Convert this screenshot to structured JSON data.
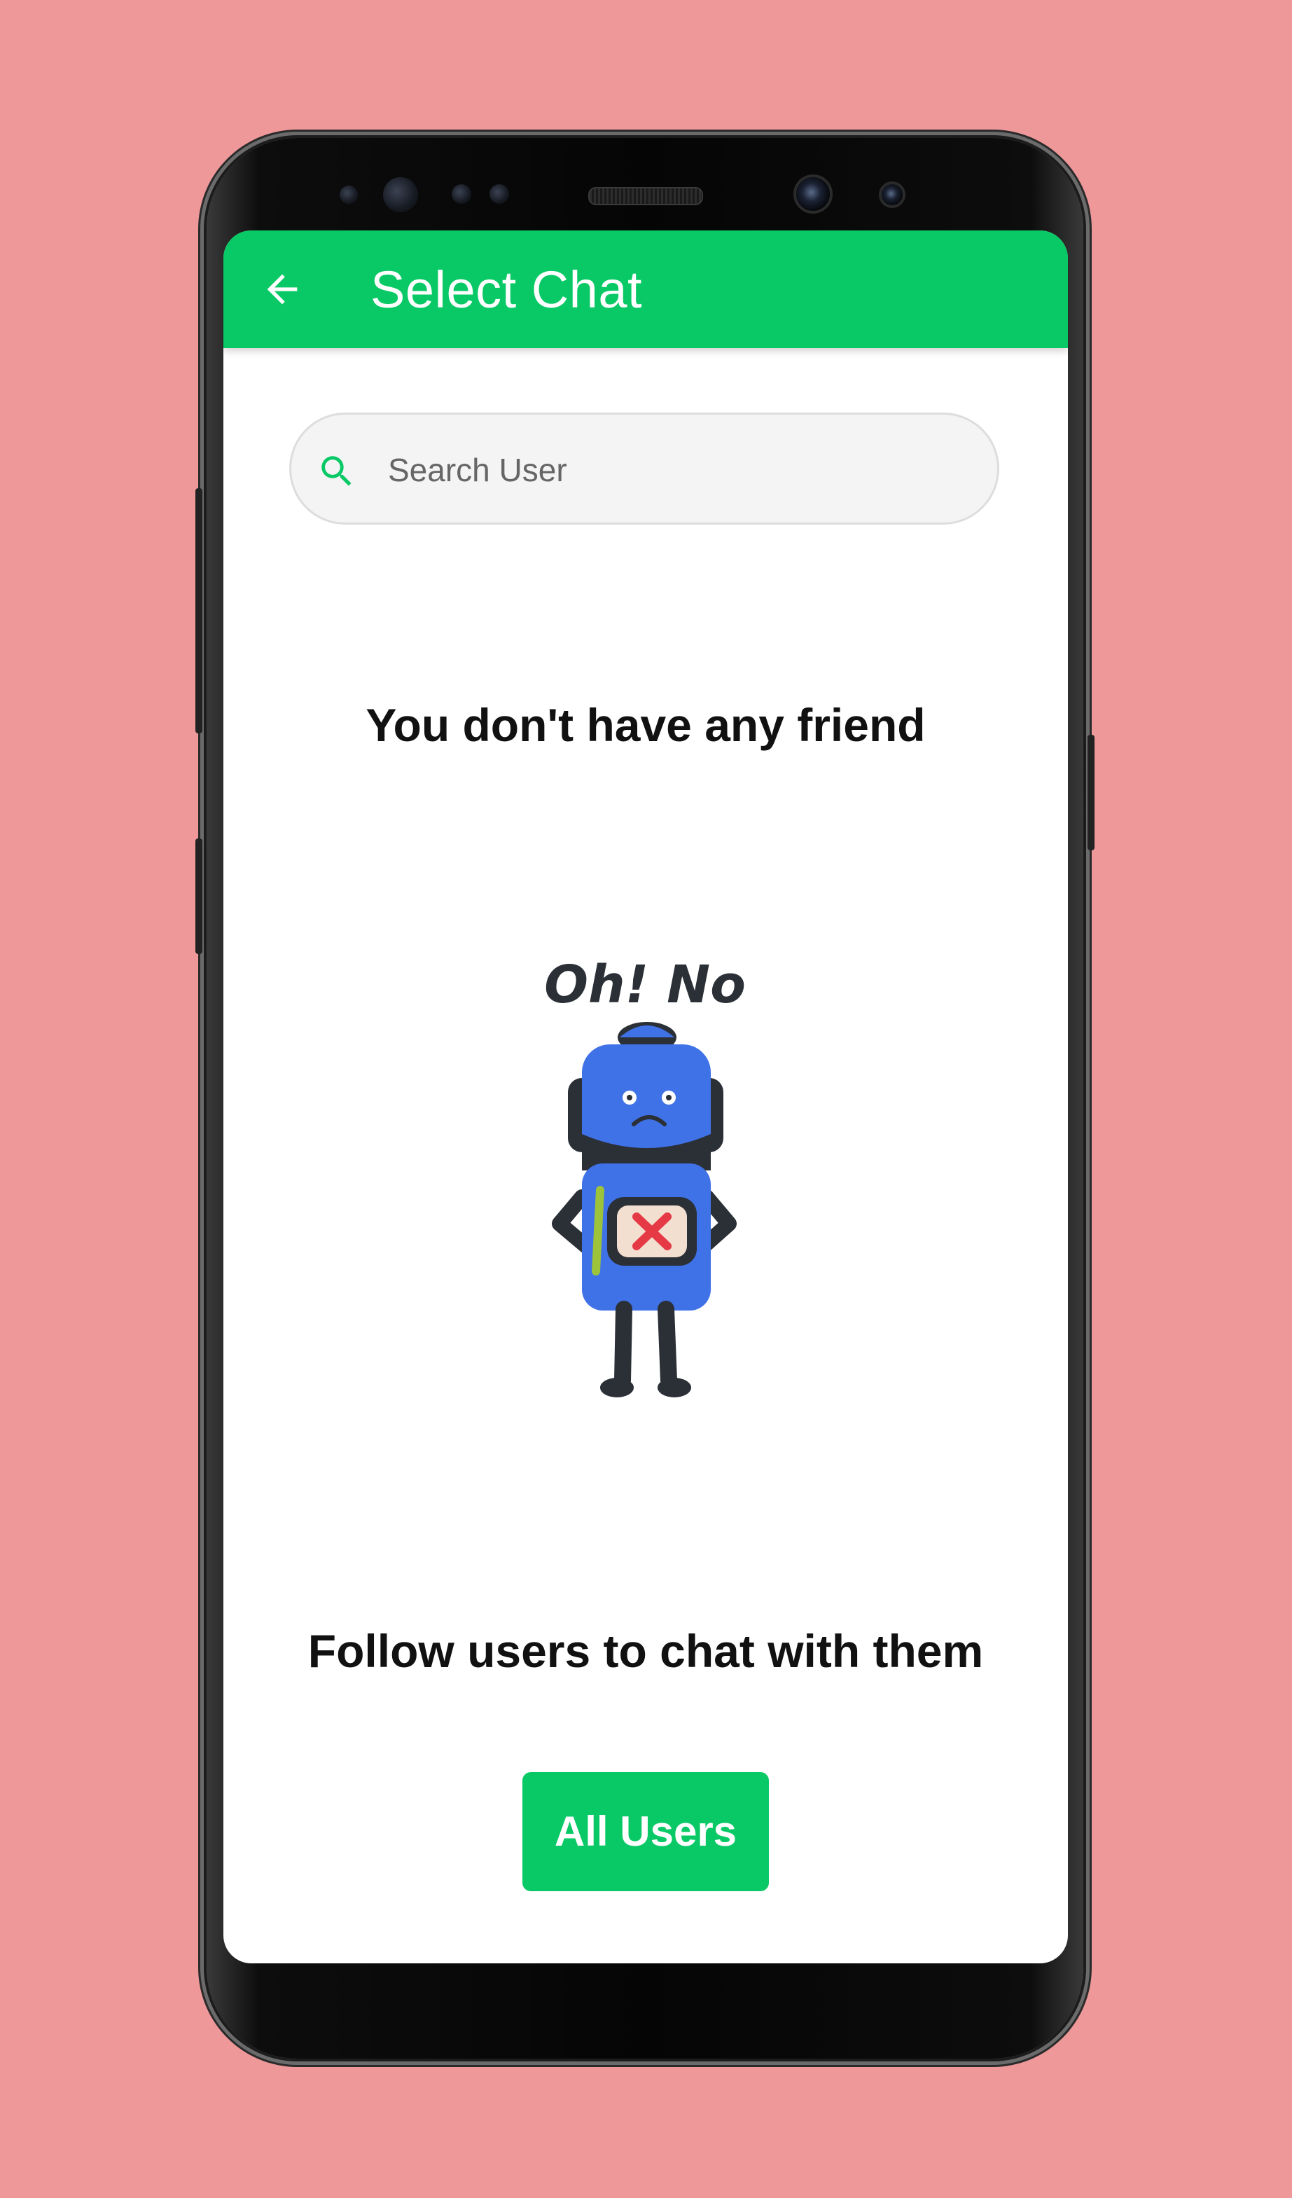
{
  "app_bar": {
    "title": "Select Chat",
    "back_icon": "arrow-left-icon",
    "background": "#08c965"
  },
  "search": {
    "placeholder": "Search User",
    "value": "",
    "icon": "search-icon",
    "icon_color": "#08c965"
  },
  "empty_state": {
    "title": "You don't have any friend",
    "illustration_caption": "Oh! No",
    "illustration_icon": "sad-robot-illustration",
    "message": "Follow users to chat with them"
  },
  "action": {
    "all_users_label": "All Users",
    "color": "#08c965"
  },
  "theme": {
    "page_background": "#ee9899",
    "robot_body": "#3f72e6",
    "robot_dark": "#2b2f36",
    "cross_color": "#e63946"
  }
}
